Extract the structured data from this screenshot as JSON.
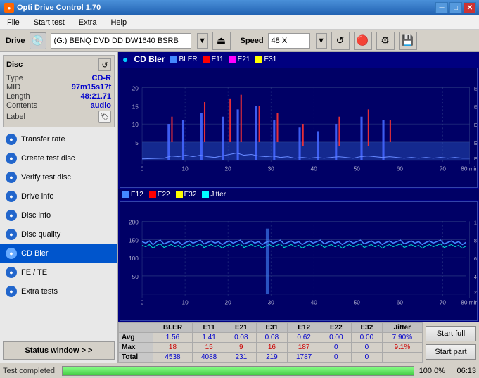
{
  "titleBar": {
    "title": "Opti Drive Control 1.70",
    "icon": "●",
    "minimize": "─",
    "maximize": "□",
    "close": "✕"
  },
  "menu": {
    "items": [
      "File",
      "Start test",
      "Extra",
      "Help"
    ]
  },
  "drive": {
    "label": "Drive",
    "icon": "💿",
    "value": "(G:)  BENQ DVD DD DW1640 BSRB",
    "speedLabel": "Speed",
    "speedValue": "48 X"
  },
  "disc": {
    "title": "Disc",
    "type_label": "Type",
    "type_val": "CD-R",
    "mid_label": "MID",
    "mid_val": "97m15s17f",
    "length_label": "Length",
    "length_val": "48:21.71",
    "contents_label": "Contents",
    "contents_val": "audio",
    "label_label": "Label"
  },
  "nav": {
    "items": [
      {
        "id": "transfer-rate",
        "label": "Transfer rate",
        "active": false
      },
      {
        "id": "create-test-disc",
        "label": "Create test disc",
        "active": false
      },
      {
        "id": "verify-test-disc",
        "label": "Verify test disc",
        "active": false
      },
      {
        "id": "drive-info",
        "label": "Drive info",
        "active": false
      },
      {
        "id": "disc-info",
        "label": "Disc info",
        "active": false
      },
      {
        "id": "disc-quality",
        "label": "Disc quality",
        "active": false
      },
      {
        "id": "cd-bler",
        "label": "CD Bler",
        "active": true
      },
      {
        "id": "fe-te",
        "label": "FE / TE",
        "active": false
      },
      {
        "id": "extra-tests",
        "label": "Extra tests",
        "active": false
      }
    ],
    "statusWindow": "Status window > >"
  },
  "chart": {
    "title": "CD Bler",
    "topLegend": [
      "BLER",
      "E11",
      "E21",
      "E31"
    ],
    "topColors": [
      "#4488ff",
      "#ff0000",
      "#ff00ff",
      "#ffff00"
    ],
    "bottomLegend": [
      "E12",
      "E22",
      "E32",
      "Jitter"
    ],
    "bottomColors": [
      "#4488ff",
      "#ff0000",
      "#ffff00",
      "#00ffff"
    ],
    "xMax": 80,
    "topYMax": 20,
    "bottomYMax": 200
  },
  "stats": {
    "columns": [
      "BLER",
      "E11",
      "E21",
      "E31",
      "E12",
      "E22",
      "E32",
      "Jitter"
    ],
    "rows": [
      {
        "label": "Avg",
        "values": [
          "1.56",
          "1.41",
          "0.08",
          "0.08",
          "0.62",
          "0.00",
          "0.00",
          "7.90%"
        ]
      },
      {
        "label": "Max",
        "values": [
          "18",
          "15",
          "9",
          "16",
          "187",
          "0",
          "0",
          "9.1%"
        ]
      },
      {
        "label": "Total",
        "values": [
          "4538",
          "4088",
          "231",
          "219",
          "1787",
          "0",
          "0",
          ""
        ]
      }
    ]
  },
  "buttons": {
    "startFull": "Start full",
    "startPart": "Start part"
  },
  "statusBar": {
    "text": "Test completed",
    "progress": 100,
    "progressText": "100.0%",
    "elapsed": "06:13"
  }
}
